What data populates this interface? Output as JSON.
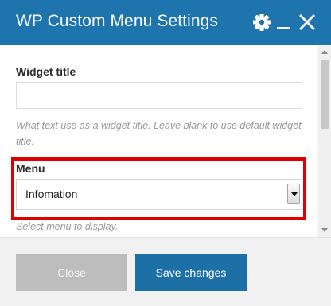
{
  "dialog": {
    "title": "WP Custom Menu Settings",
    "icons": [
      "gear-icon",
      "minimize-icon",
      "close-icon"
    ],
    "accent_color": "#1e74ad"
  },
  "form": {
    "widget_title": {
      "label": "Widget title",
      "value": "",
      "description": "What text use as a widget title. Leave blank to use default widget title."
    },
    "menu": {
      "label": "Menu",
      "selected": "Infomation",
      "description": "Select menu to display."
    }
  },
  "footer": {
    "close_label": "Close",
    "save_label": "Save changes"
  },
  "highlight_color": "#e00000"
}
